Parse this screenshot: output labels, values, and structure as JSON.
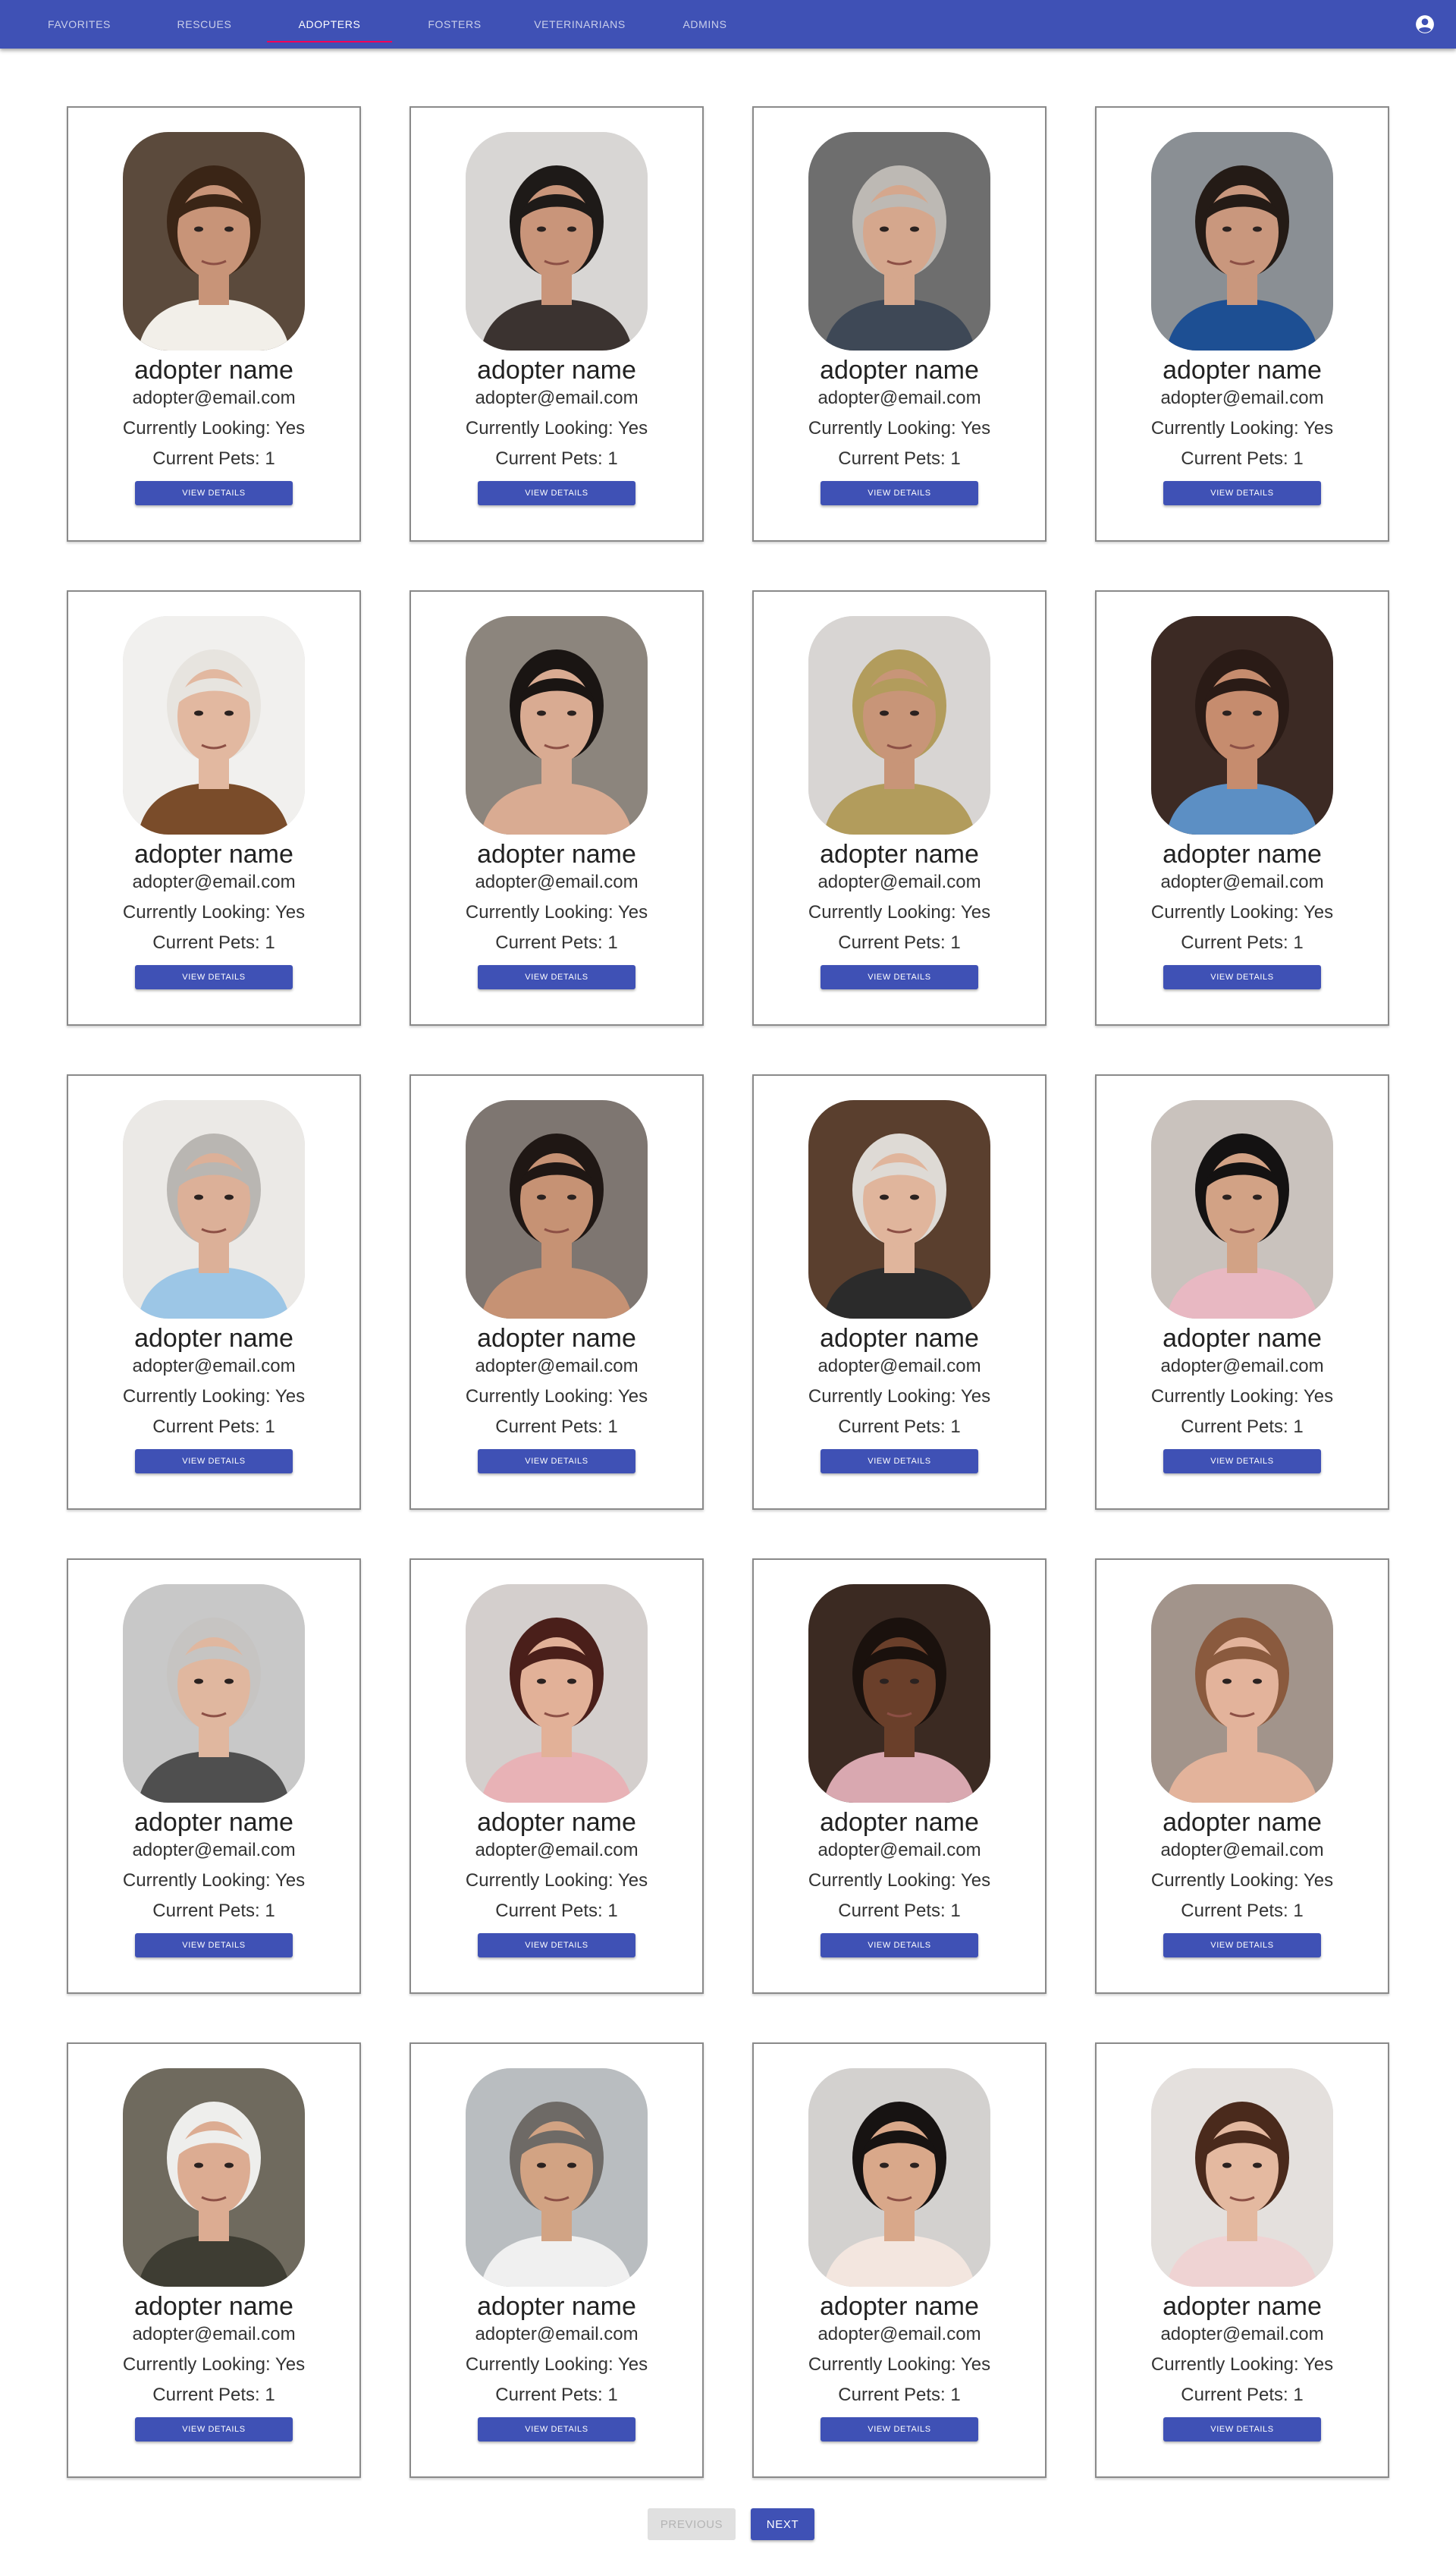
{
  "nav": {
    "tabs": [
      {
        "label": "Favorites",
        "active": false
      },
      {
        "label": "Rescues",
        "active": false
      },
      {
        "label": "Adopters",
        "active": true
      },
      {
        "label": "Fosters",
        "active": false
      },
      {
        "label": "Veterinarians",
        "active": false
      },
      {
        "label": "Admins",
        "active": false
      }
    ],
    "account_icon": "account-circle-icon"
  },
  "colors": {
    "primary": "#3f51b5",
    "indicator": "#f50057"
  },
  "adopters": [
    {
      "name": "adopter name",
      "email": "adopter@email.com",
      "looking": "Currently Looking: Yes",
      "pets": "Current Pets: 1",
      "button": "View Details",
      "photo": {
        "bg": "#5b4a3c",
        "skin": "#c89478",
        "hair": "#3a2516",
        "shirt": "#f2efe9"
      }
    },
    {
      "name": "adopter name",
      "email": "adopter@email.com",
      "looking": "Currently Looking: Yes",
      "pets": "Current Pets: 1",
      "button": "View Details",
      "photo": {
        "bg": "#d8d6d4",
        "skin": "#c9957a",
        "hair": "#1e1a18",
        "shirt": "#3b3330"
      }
    },
    {
      "name": "adopter name",
      "email": "adopter@email.com",
      "looking": "Currently Looking: Yes",
      "pets": "Current Pets: 1",
      "button": "View Details",
      "photo": {
        "bg": "#6e6e6e",
        "skin": "#d5a78d",
        "hair": "#bdb9b4",
        "shirt": "#3e4856"
      }
    },
    {
      "name": "adopter name",
      "email": "adopter@email.com",
      "looking": "Currently Looking: Yes",
      "pets": "Current Pets: 1",
      "button": "View Details",
      "photo": {
        "bg": "#8a8f94",
        "skin": "#c9977d",
        "hair": "#241b16",
        "shirt": "#1d4f93"
      }
    },
    {
      "name": "adopter name",
      "email": "adopter@email.com",
      "looking": "Currently Looking: Yes",
      "pets": "Current Pets: 1",
      "button": "View Details",
      "photo": {
        "bg": "#f1f0ee",
        "skin": "#e2b8a0",
        "hair": "#e7e4df",
        "shirt": "#7a4c2a"
      }
    },
    {
      "name": "adopter name",
      "email": "adopter@email.com",
      "looking": "Currently Looking: Yes",
      "pets": "Current Pets: 1",
      "button": "View Details",
      "photo": {
        "bg": "#8c857d",
        "skin": "#d9ab92",
        "hair": "#1a1513",
        "shirt": "#d9ab92"
      }
    },
    {
      "name": "adopter name",
      "email": "adopter@email.com",
      "looking": "Currently Looking: Yes",
      "pets": "Current Pets: 1",
      "button": "View Details",
      "photo": {
        "bg": "#d8d5d3",
        "skin": "#c89578",
        "hair": "#b29c5c",
        "shirt": "#b29c5c"
      }
    },
    {
      "name": "adopter name",
      "email": "adopter@email.com",
      "looking": "Currently Looking: Yes",
      "pets": "Current Pets: 1",
      "button": "View Details",
      "photo": {
        "bg": "#3c2a24",
        "skin": "#c68c6e",
        "hair": "#2a1b16",
        "shirt": "#5c8fc4"
      }
    },
    {
      "name": "adopter name",
      "email": "adopter@email.com",
      "looking": "Currently Looking: Yes",
      "pets": "Current Pets: 1",
      "button": "View Details",
      "photo": {
        "bg": "#ebe9e6",
        "skin": "#dcb098",
        "hair": "#b9b6b2",
        "shirt": "#9cc6e6"
      }
    },
    {
      "name": "adopter name",
      "email": "adopter@email.com",
      "looking": "Currently Looking: Yes",
      "pets": "Current Pets: 1",
      "button": "View Details",
      "photo": {
        "bg": "#7e7671",
        "skin": "#c69274",
        "hair": "#1f1714",
        "shirt": "#c69274"
      }
    },
    {
      "name": "adopter name",
      "email": "adopter@email.com",
      "looking": "Currently Looking: Yes",
      "pets": "Current Pets: 1",
      "button": "View Details",
      "photo": {
        "bg": "#5a3f2e",
        "skin": "#e0b59c",
        "hair": "#dedad5",
        "shirt": "#2b2b2b"
      }
    },
    {
      "name": "adopter name",
      "email": "adopter@email.com",
      "looking": "Currently Looking: Yes",
      "pets": "Current Pets: 1",
      "button": "View Details",
      "photo": {
        "bg": "#c9c2bd",
        "skin": "#d2a285",
        "hair": "#141212",
        "shirt": "#e8b8c2"
      }
    },
    {
      "name": "adopter name",
      "email": "adopter@email.com",
      "looking": "Currently Looking: Yes",
      "pets": "Current Pets: 1",
      "button": "View Details",
      "photo": {
        "bg": "#c8c8c8",
        "skin": "#e0b79f",
        "hair": "#c6c4c2",
        "shirt": "#4f4f4f"
      }
    },
    {
      "name": "adopter name",
      "email": "adopter@email.com",
      "looking": "Currently Looking: Yes",
      "pets": "Current Pets: 1",
      "button": "View Details",
      "photo": {
        "bg": "#d4cfcd",
        "skin": "#e2b198",
        "hair": "#4a1f1a",
        "shirt": "#e8b2b6"
      }
    },
    {
      "name": "adopter name",
      "email": "adopter@email.com",
      "looking": "Currently Looking: Yes",
      "pets": "Current Pets: 1",
      "button": "View Details",
      "photo": {
        "bg": "#3b2a22",
        "skin": "#6a3f2a",
        "hair": "#1a110d",
        "shirt": "#d9a8b0"
      }
    },
    {
      "name": "adopter name",
      "email": "adopter@email.com",
      "looking": "Currently Looking: Yes",
      "pets": "Current Pets: 1",
      "button": "View Details",
      "photo": {
        "bg": "#a2948b",
        "skin": "#e3b39b",
        "hair": "#8a5a3e",
        "shirt": "#e3b39b"
      }
    },
    {
      "name": "adopter name",
      "email": "adopter@email.com",
      "looking": "Currently Looking: Yes",
      "pets": "Current Pets: 1",
      "button": "View Details",
      "photo": {
        "bg": "#6f6a5e",
        "skin": "#dcac92",
        "hair": "#eeeeec",
        "shirt": "#3e3d33"
      }
    },
    {
      "name": "adopter name",
      "email": "adopter@email.com",
      "looking": "Currently Looking: Yes",
      "pets": "Current Pets: 1",
      "button": "View Details",
      "photo": {
        "bg": "#b9bdc0",
        "skin": "#d2a383",
        "hair": "#6e6a66",
        "shirt": "#f0f0f0"
      }
    },
    {
      "name": "adopter name",
      "email": "adopter@email.com",
      "looking": "Currently Looking: Yes",
      "pets": "Current Pets: 1",
      "button": "View Details",
      "photo": {
        "bg": "#d3d1cf",
        "skin": "#d9a88a",
        "hair": "#171312",
        "shirt": "#f3e6df"
      }
    },
    {
      "name": "adopter name",
      "email": "adopter@email.com",
      "looking": "Currently Looking: Yes",
      "pets": "Current Pets: 1",
      "button": "View Details",
      "photo": {
        "bg": "#e4e0dd",
        "skin": "#e4b9a0",
        "hair": "#4a2a1c",
        "shirt": "#efd3d3"
      }
    }
  ],
  "pagination": {
    "previous_label": "Previous",
    "next_label": "Next",
    "previous_disabled": true
  }
}
